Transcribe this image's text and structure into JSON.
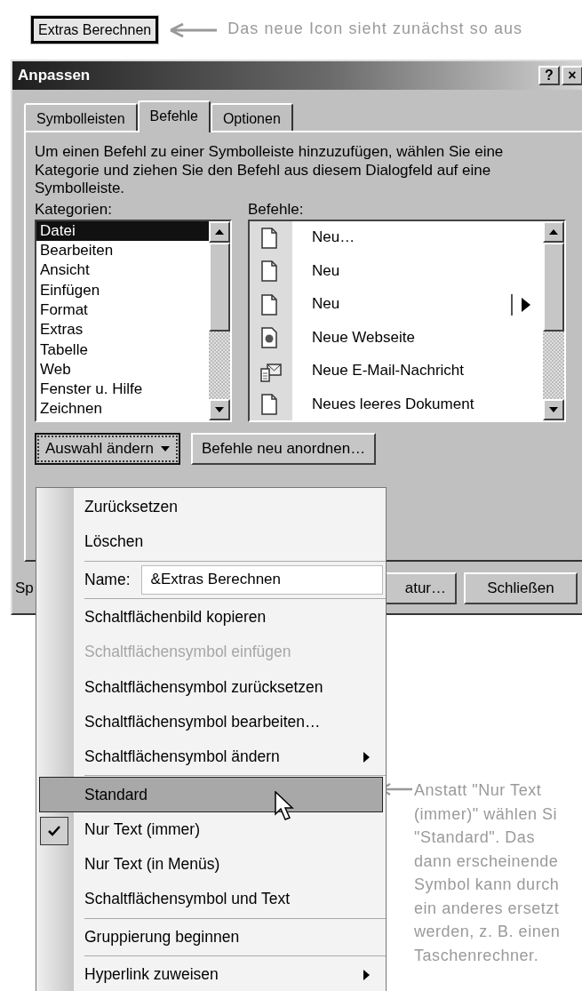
{
  "top_button": {
    "label": "Extras Berechnen"
  },
  "top_note": "Das neue Icon sieht zunächst so aus",
  "dialog": {
    "title": "Anpassen",
    "title_buttons": [
      "?",
      "×"
    ],
    "tabs": [
      {
        "label": "Symbolleisten",
        "selected": false
      },
      {
        "label": "Befehle",
        "selected": true
      },
      {
        "label": "Optionen",
        "selected": false
      }
    ],
    "description": "Um einen Befehl zu einer Symbolleiste hinzuzufügen, wählen Sie eine Kategorie und ziehen Sie den Befehl aus diesem Dialogfeld auf eine Symbolleiste.",
    "categories": {
      "label": "Kategorien:",
      "items": [
        {
          "label": "Datei",
          "selected": true
        },
        {
          "label": "Bearbeiten",
          "selected": false
        },
        {
          "label": "Ansicht",
          "selected": false
        },
        {
          "label": "Einfügen",
          "selected": false
        },
        {
          "label": "Format",
          "selected": false
        },
        {
          "label": "Extras",
          "selected": false
        },
        {
          "label": "Tabelle",
          "selected": false
        },
        {
          "label": "Web",
          "selected": false
        },
        {
          "label": "Fenster u. Hilfe",
          "selected": false
        },
        {
          "label": "Zeichnen",
          "selected": false
        }
      ]
    },
    "commands": {
      "label": "Befehle:",
      "items": [
        {
          "label": "Neu…",
          "kind": "document",
          "submenu": false
        },
        {
          "label": "Neu",
          "kind": "document",
          "submenu": false
        },
        {
          "label": "Neu",
          "kind": "document",
          "submenu": true
        },
        {
          "label": "Neue Webseite",
          "kind": "web",
          "submenu": false
        },
        {
          "label": "Neue E-Mail-Nachricht",
          "kind": "mail",
          "submenu": false
        },
        {
          "label": "Neues leeres Dokument",
          "kind": "document",
          "submenu": false
        }
      ]
    },
    "buttons": [
      {
        "label": "Auswahl ändern",
        "dropdown": true,
        "pressed": true
      },
      {
        "label": "Befehle neu anordnen…",
        "dropdown": false,
        "pressed": false
      }
    ],
    "footer": {
      "label": "Sp",
      "buttons": [
        "atur…",
        "Schließen"
      ]
    }
  },
  "menu": {
    "items": [
      {
        "kind": "item",
        "label": "Zurücksetzen",
        "disabled": false,
        "checked": false,
        "selected": false,
        "submenu": false
      },
      {
        "kind": "item",
        "label": "Löschen",
        "disabled": false,
        "checked": false,
        "selected": false,
        "submenu": false
      },
      {
        "kind": "separator"
      },
      {
        "kind": "field",
        "label": "Name:",
        "value": "&Extras Berechnen"
      },
      {
        "kind": "separator"
      },
      {
        "kind": "item",
        "label": "Schaltflächenbild kopieren",
        "disabled": false,
        "checked": false,
        "selected": false,
        "submenu": false
      },
      {
        "kind": "item",
        "label": "Schaltflächensymbol einfügen",
        "disabled": true,
        "checked": false,
        "selected": false,
        "submenu": false
      },
      {
        "kind": "item",
        "label": "Schaltflächensymbol zurücksetzen",
        "disabled": false,
        "checked": false,
        "selected": false,
        "submenu": false
      },
      {
        "kind": "item",
        "label": "Schaltflächensymbol bearbeiten…",
        "disabled": false,
        "checked": false,
        "selected": false,
        "submenu": false
      },
      {
        "kind": "item",
        "label": "Schaltflächensymbol ändern",
        "disabled": false,
        "checked": false,
        "selected": false,
        "submenu": true
      },
      {
        "kind": "separator"
      },
      {
        "kind": "item",
        "label": "Standard",
        "disabled": false,
        "checked": false,
        "selected": true,
        "submenu": false
      },
      {
        "kind": "item",
        "label": "Nur Text (immer)",
        "disabled": false,
        "checked": true,
        "selected": false,
        "submenu": false
      },
      {
        "kind": "item",
        "label": "Nur Text (in Menüs)",
        "disabled": false,
        "checked": false,
        "selected": false,
        "submenu": false
      },
      {
        "kind": "item",
        "label": "Schaltflächensymbol und Text",
        "disabled": false,
        "checked": false,
        "selected": false,
        "submenu": false
      },
      {
        "kind": "separator"
      },
      {
        "kind": "item",
        "label": "Gruppierung beginnen",
        "disabled": false,
        "checked": false,
        "selected": false,
        "submenu": false
      },
      {
        "kind": "separator"
      },
      {
        "kind": "item",
        "label": "Hyperlink zuweisen",
        "disabled": false,
        "checked": false,
        "selected": false,
        "submenu": true
      }
    ]
  },
  "note": {
    "lines": [
      "Anstatt \"Nur Text",
      "(immer)\" wählen Si",
      "\"Standard\". Das",
      "dann erscheinende",
      "Symbol kann durch",
      "ein anderes ersetzt",
      "werden, z. B. einen",
      "Taschenrechner."
    ]
  }
}
